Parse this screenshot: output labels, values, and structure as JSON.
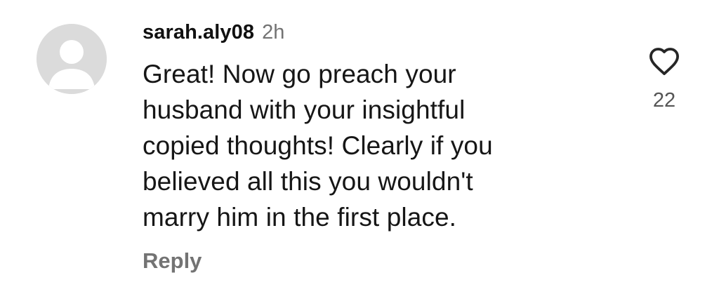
{
  "comment": {
    "username": "sarah.aly08",
    "time": "2h",
    "text_lines": [
      "Great! Now go preach your",
      "husband with your insightful",
      "copied thoughts! Clearly if you",
      "believed all this you wouldn't",
      "marry him in the first place."
    ],
    "reply_label": "Reply",
    "like_count": "22",
    "avatar_icon": "default-avatar-icon",
    "like_icon": "heart-outline-icon",
    "colors": {
      "avatar_bg": "#dbdbdb",
      "avatar_fg": "#ffffff",
      "secondary_text": "#737373"
    }
  }
}
